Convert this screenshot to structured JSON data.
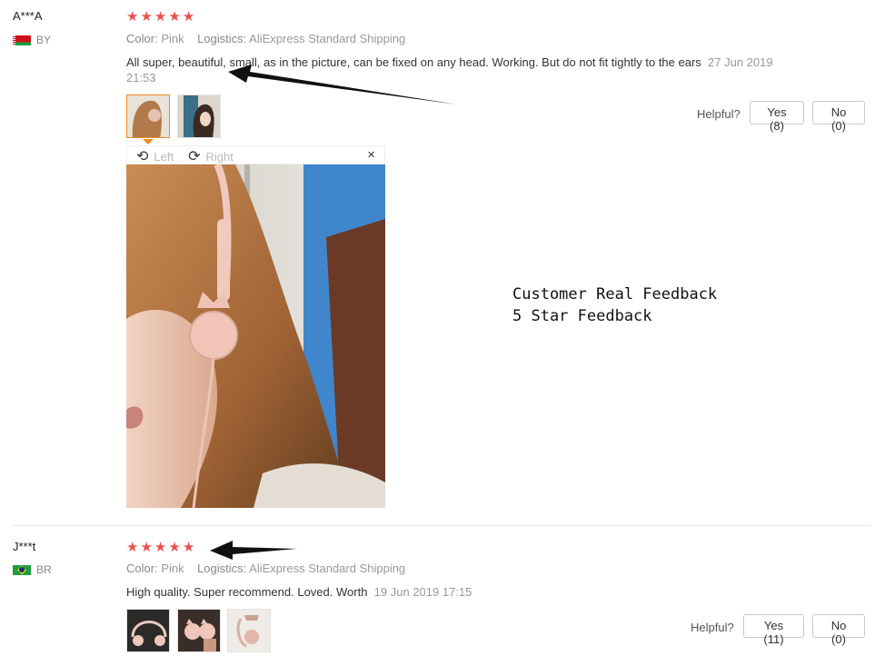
{
  "reviews": [
    {
      "user": "A***A",
      "country": "BY",
      "stars": 5,
      "color_label": "Color:",
      "color_value": "Pink",
      "logistics_label": "Logistics:",
      "logistics_value": "AliExpress Standard Shipping",
      "text": "All super, beautiful, small, as in the picture, can be fixed on any head. Working. But do not fit tightly to the ears",
      "date": "27 Jun 2019 21:53",
      "helpful_label": "Helpful?",
      "yes_label": "Yes (8)",
      "no_label": "No (0)",
      "photo_toolbar": {
        "left": "Left",
        "right": "Right",
        "close": "×"
      }
    },
    {
      "user": "J***t",
      "country": "BR",
      "stars": 5,
      "color_label": "Color:",
      "color_value": "Pink",
      "logistics_label": "Logistics:",
      "logistics_value": "AliExpress Standard Shipping",
      "text": "High quality. Super recommend. Loved. Worth",
      "date": "19 Jun 2019 17:15",
      "helpful_label": "Helpful?",
      "yes_label": "Yes (11)",
      "no_label": "No (0)"
    }
  ],
  "overlay": {
    "line1": "Customer Real Feedback",
    "line2": "5 Star Feedback"
  },
  "colors": {
    "star": "#e8514e",
    "active_thumb_border": "#f08a24",
    "arrow": "#111111"
  }
}
